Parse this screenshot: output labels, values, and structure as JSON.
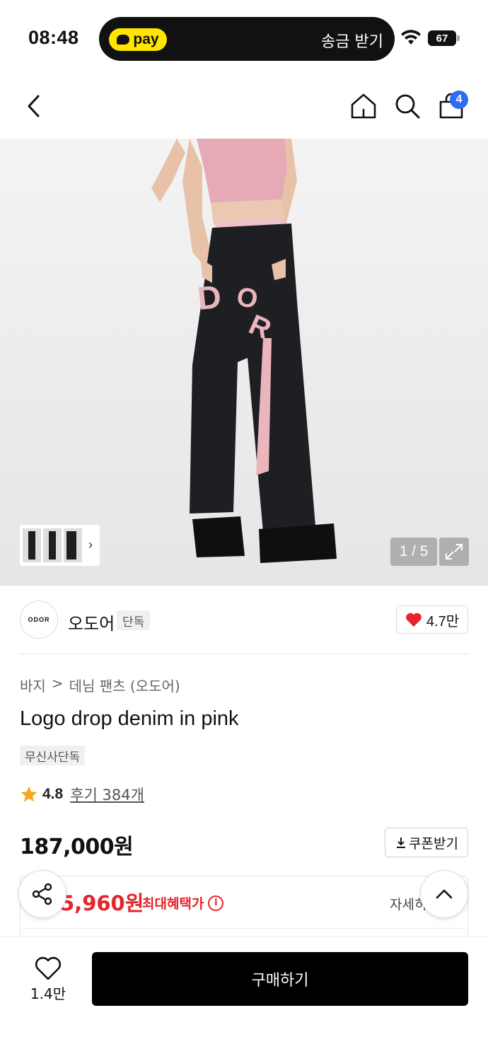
{
  "status_bar": {
    "time": "08:48",
    "pay_label": "pay",
    "send_receive": "송금 받기",
    "battery": "67"
  },
  "nav": {
    "cart_count": "4",
    "icons": [
      "back-chevron-icon",
      "home-icon",
      "search-icon",
      "shopping-bag-icon"
    ]
  },
  "gallery": {
    "counter": "1 / 5",
    "brand_print": "ODOR"
  },
  "brand": {
    "logo_text": "ODOR",
    "name": "오도어",
    "tag": "단독",
    "like_count": "4.7만"
  },
  "product": {
    "breadcrumb": [
      "바지",
      "데님 팬츠 (오도어)"
    ],
    "breadcrumb_separator": ">",
    "title": "Logo drop denim in pink",
    "tag": "무신사단독",
    "rating": "4.8",
    "reviews": "후기 384개",
    "price": "187,000원",
    "coupon_label": "쿠폰받기"
  },
  "benefit": {
    "price": "5,960원",
    "label": "최대혜택가",
    "detail": "자세히"
  },
  "bottom": {
    "wish_count": "1.4만",
    "buy_label": "구매하기"
  },
  "colors": {
    "accent_red": "#e5242b",
    "cart_badge": "#2f6bf5",
    "pay_yellow": "#ffe600",
    "star": "#f5a623"
  }
}
